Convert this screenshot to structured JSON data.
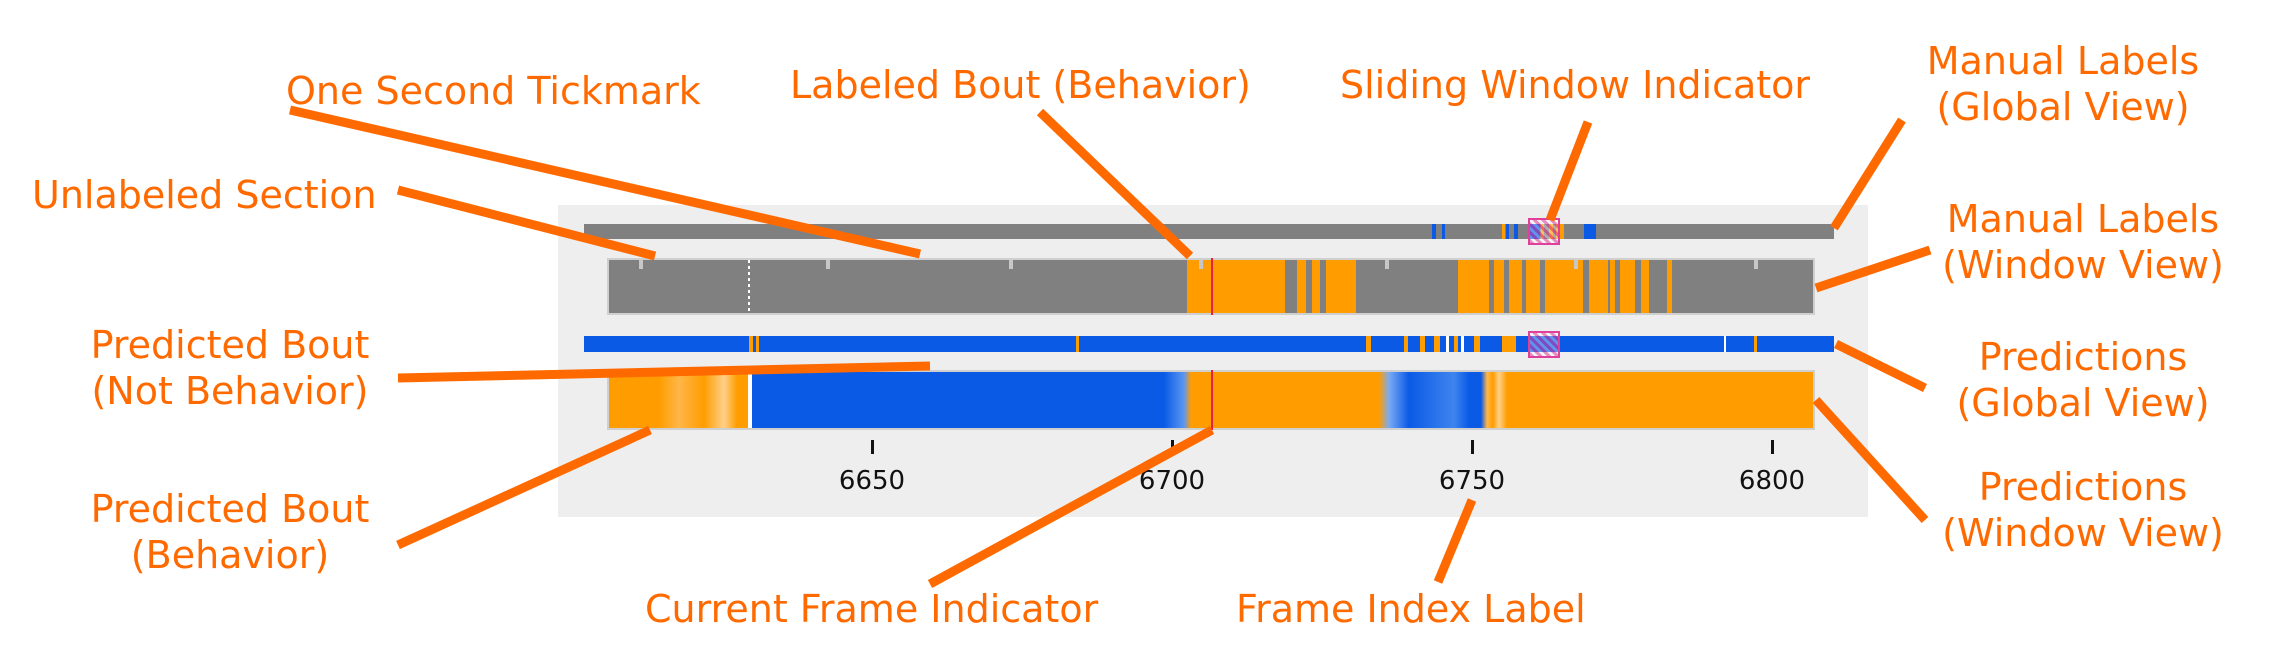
{
  "axis": {
    "ticks": [
      "6650",
      "6700",
      "6750",
      "6800"
    ]
  },
  "callouts": {
    "one_second_tickmark": "One Second Tickmark",
    "labeled_bout": "Labeled Bout (Behavior)",
    "sliding_window": "Sliding Window Indicator",
    "manual_global_1": "Manual Labels",
    "manual_global_2": "(Global View)",
    "unlabeled_section": "Unlabeled Section",
    "manual_window_1": "Manual Labels",
    "manual_window_2": "(Window View)",
    "pred_not_1": "Predicted Bout",
    "pred_not_2": "(Not Behavior)",
    "pred_global_1": "Predictions",
    "pred_global_2": "(Global View)",
    "pred_window_1": "Predictions",
    "pred_window_2": "(Window View)",
    "pred_beh_1": "Predicted Bout",
    "pred_beh_2": "(Behavior)",
    "current_frame": "Current Frame Indicator",
    "frame_index": "Frame Index Label"
  },
  "colors": {
    "annotation": "#ff6a00",
    "behavior": "#ff9d00",
    "not_behavior": "#0a5ae6",
    "unlabeled": "#808080",
    "frame_indicator": "#e8203c",
    "window_indicator": "#e0409c"
  }
}
